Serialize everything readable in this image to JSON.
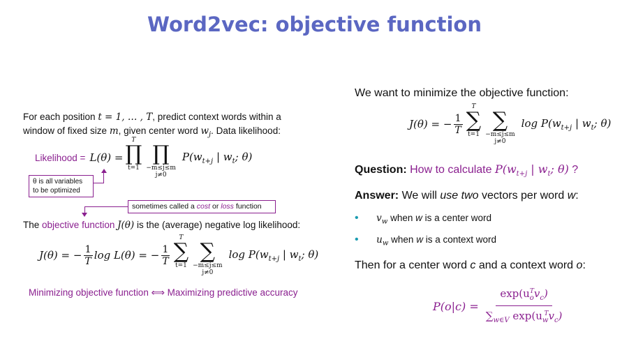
{
  "title": "Word2vec: objective function",
  "left": {
    "intro_line1": "For each position",
    "intro_line1_math": "t = 1, … , T",
    "intro_line1_rest": ", predict context words within a",
    "intro_line2": "window of fixed size",
    "intro_m": "m",
    "intro_line2_mid": ", given center word",
    "intro_w": "w",
    "intro_j": "j",
    "intro_line2_end": ". Data likelihood:",
    "likelihood_label": "Likelihood =",
    "likelihood_lhs": "L(θ) =",
    "prod_top": "T",
    "prod_bottom1": "t=1",
    "prod_bottom2": "−m≤j≤m",
    "prod_bottom3": "j≠0",
    "likelihood_rhs": "P(w",
    "likelihood_rhs_sub": "t+j",
    "likelihood_rhs_mid": "| w",
    "likelihood_rhs_sub2": "t",
    "likelihood_rhs_end": "; θ)",
    "theta_note_line1": "θ is all variables",
    "theta_note_line2": "to be optimized",
    "cost_note_pre": "sometimes called a",
    "cost_note_cost": "cost",
    "cost_note_or": "or",
    "cost_note_loss": "loss",
    "cost_note_post": "function",
    "obj_pre": "The",
    "obj_colored": "objective function",
    "obj_math": "J(θ)",
    "obj_post": "is the (average) negative log likelihood:",
    "eq2_lhs": "J(θ) = −",
    "one": "1",
    "T": "T",
    "eq2_log": "log L(θ) = −",
    "eq2_logp": "log P(w",
    "minimizing": "Minimizing objective function ⟺ Maximizing predictive accuracy"
  },
  "right": {
    "want": "We want to minimize the objective function:",
    "question_bold": "Question:",
    "question_text": "How to calculate",
    "question_end": "?",
    "answer_bold": "Answer:",
    "answer_pre": "We will",
    "answer_italic": "use two",
    "answer_post": "vectors per word",
    "answer_w": "w",
    "answer_colon": ":",
    "bullet1_math": "v",
    "bullet1_text_pre": "when",
    "bullet1_w": "w",
    "bullet1_text_post": "is a center word",
    "bullet2_math": "u",
    "bullet2_text_pre": "when",
    "bullet2_w": "w",
    "bullet2_text_post": "is a context word",
    "then_pre": "Then for a center word",
    "then_c": "c",
    "then_mid": "and a context word",
    "then_o": "o",
    "then_colon": ":",
    "poc": "P(o|c) =",
    "num": "exp(u",
    "den_sum": "∑",
    "den_sub": "w∈V",
    "den_exp": "exp(u"
  },
  "colors": {
    "title": "#5b67c2",
    "purple": "#8a1f8f",
    "bullet": "#1a9bb0"
  }
}
